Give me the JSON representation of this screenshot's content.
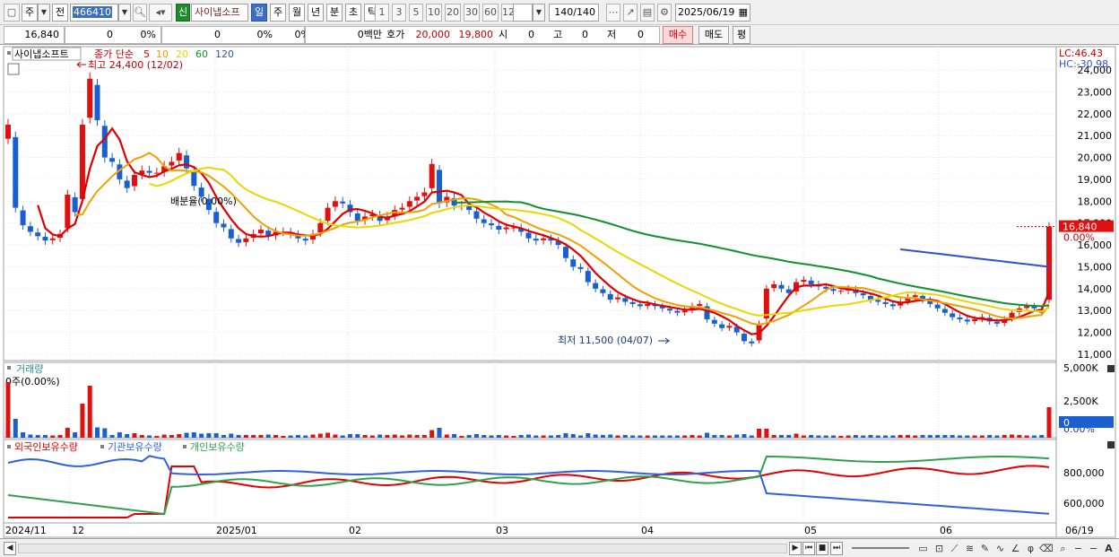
{
  "toolbar": {
    "period_select": "주",
    "prev_label": "전",
    "stock_code": "466410",
    "stock_badge": "신",
    "stock_name": "사이냅소프",
    "periods": [
      "일",
      "주",
      "월",
      "년",
      "분",
      "초",
      "틱"
    ],
    "active_period": "일",
    "intervals": [
      "1",
      "3",
      "5",
      "10",
      "20",
      "30",
      "60",
      "120"
    ],
    "bar_count": "140/140",
    "date": "2025/06/19"
  },
  "quote": {
    "price": "16,840",
    "change": "0",
    "change_pct": "0%",
    "volume": "0",
    "volume_pct": "0%",
    "volume_pct2": "0%",
    "amount": "0백만",
    "ask_label": "호가",
    "ask": "20,000",
    "bid": "19,800",
    "open_label": "시",
    "open": "0",
    "high_label": "고",
    "high": "0",
    "low_label": "저",
    "low": "0",
    "buy_label": "매수",
    "sell_label": "매도",
    "eval_label": "평"
  },
  "legend": {
    "name": "사이냅소프트",
    "ma_label": "종가 단순",
    "ma_periods": [
      "5",
      "10",
      "20",
      "60",
      "120"
    ],
    "ma_colors": [
      "#e00000",
      "#f0a000",
      "#e8d800",
      "#109030",
      "#3050d0"
    ],
    "max_label": "최고 24,400 (12/02)",
    "min_label": "최저 11,500 (04/07)",
    "ratio_label": "배분율(0.00%)",
    "lc": "LC:46.43",
    "hc": "HC:-30.98"
  },
  "price_axis": [
    "24,000",
    "23,000",
    "22,000",
    "21,000",
    "20,000",
    "19,000",
    "18,000",
    "17,000",
    "16,000",
    "15,000",
    "14,000",
    "13,000",
    "12,000",
    "11,000"
  ],
  "price_tag": "16,840",
  "price_pct_tag": "0.00%",
  "volume_panel": {
    "title": "거래량",
    "sub": "0주(0.00%)",
    "axis": [
      "5,000K",
      "2,500K",
      "0.00%"
    ],
    "tag": "0"
  },
  "holdings_panel": {
    "labels": [
      "외국인보유수량",
      "기관보유수량",
      "개인보유수량"
    ],
    "colors": [
      "#e00000",
      "#3060e0",
      "#30a050"
    ],
    "axis": [
      "800,000",
      "600,000"
    ]
  },
  "x_axis": [
    "2024/11",
    "12",
    "2025/01",
    "02",
    "03",
    "04",
    "05",
    "06",
    "06/19"
  ],
  "colors": {
    "up": "#e01010",
    "down": "#1a5fd0"
  },
  "chart_data": {
    "type": "candlestick",
    "title": "사이냅소프트",
    "ylim": [
      11000,
      24000
    ],
    "latest_close": 16840,
    "high": {
      "value": 24400,
      "date": "12/02"
    },
    "low": {
      "value": 11500,
      "date": "04/07"
    },
    "series": [
      {
        "name": "5",
        "color": "#e00000"
      },
      {
        "name": "10",
        "color": "#f0a000"
      },
      {
        "name": "20",
        "color": "#e8d800"
      },
      {
        "name": "60",
        "color": "#109030"
      },
      {
        "name": "120",
        "color": "#3050d0"
      }
    ],
    "closes": [
      21500,
      17700,
      16900,
      16600,
      16400,
      16200,
      16300,
      16500,
      18300,
      17500,
      21500,
      23600,
      21700,
      20000,
      19800,
      19000,
      18600,
      19200,
      19400,
      19300,
      19300,
      19600,
      19800,
      20200,
      19500,
      18700,
      18200,
      17600,
      17000,
      16800,
      16300,
      16100,
      16300,
      16500,
      16700,
      16400,
      16600,
      16600,
      16500,
      16300,
      16200,
      16500,
      17000,
      17700,
      18000,
      17900,
      17500,
      17100,
      17300,
      17400,
      17100,
      17300,
      17600,
      17700,
      18000,
      18200,
      18400,
      19700,
      17900,
      18200,
      17800,
      17800,
      17600,
      17200,
      17000,
      16900,
      16700,
      16800,
      16800,
      16600,
      16300,
      16200,
      16300,
      16200,
      16000,
      15400,
      15000,
      14900,
      14300,
      14000,
      13800,
      13500,
      13600,
      13400,
      13300,
      13200,
      13300,
      13200,
      13100,
      13000,
      12900,
      13000,
      13200,
      13300,
      12600,
      12400,
      12200,
      12300,
      12000,
      11600,
      11500,
      12400,
      14000,
      14200,
      14000,
      13800,
      14300,
      14400,
      14200,
      14100,
      14000,
      13900,
      13900,
      14000,
      13800,
      13700,
      13500,
      13400,
      13300,
      13200,
      13400,
      13600,
      13700,
      13500,
      13300,
      13100,
      12900,
      12700,
      12600,
      12500,
      12600,
      12700,
      12500,
      12400,
      12600,
      12900,
      13100,
      13200,
      13100,
      12900,
      16840
    ]
  }
}
